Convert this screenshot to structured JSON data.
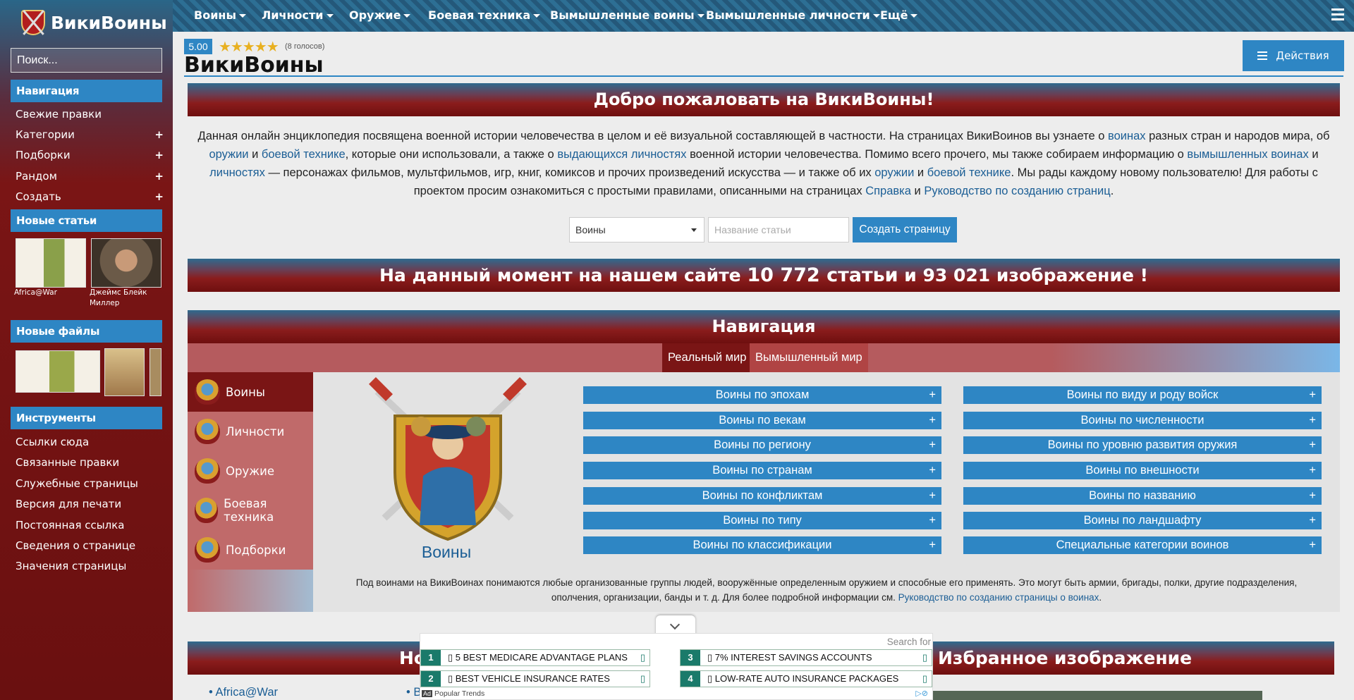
{
  "site": {
    "name": "ВикиВоины"
  },
  "topnav": {
    "items": [
      "Воины",
      "Личности",
      "Оружие",
      "Боевая техника",
      "Вымышленные воины",
      "Вымышленные личности",
      "Ещё"
    ]
  },
  "sidebar": {
    "search_placeholder": "Поиск...",
    "navigation_header": "Навигация",
    "navigation_items": [
      {
        "label": "Свежие правки",
        "plus": ""
      },
      {
        "label": "Категории",
        "plus": "+"
      },
      {
        "label": "Подборки",
        "plus": "+"
      },
      {
        "label": "Рандом",
        "plus": "+"
      },
      {
        "label": "Создать",
        "plus": "+"
      }
    ],
    "new_articles_header": "Новые статьи",
    "new_articles": [
      {
        "caption": "Africa@War"
      },
      {
        "caption": "Джеймс Блейк Миллер"
      }
    ],
    "new_files_header": "Новые файлы",
    "tools_header": "Инструменты",
    "tools_items": [
      "Ссылки сюда",
      "Связанные правки",
      "Служебные страницы",
      "Версия для печати",
      "Постоянная ссылка",
      "Сведения о странице",
      "Значения страницы"
    ]
  },
  "rating": {
    "value": "5.00",
    "votes": "(8 голосов)",
    "stars": 5
  },
  "page": {
    "title": "ВикиВоины",
    "actions_label": "Действия",
    "welcome": "Добро пожаловать на ВикиВоины!",
    "intro": {
      "t1": "Данная онлайн энциклопедия посвящена военной истории человечества в целом и её визуальной составляющей в частности. На страницах ВикиВоинов вы узнаете о ",
      "l1": "воинах",
      "t2": " разных стран и народов мира, об ",
      "l2": "оружии",
      "t3": " и ",
      "l3": "боевой технике",
      "t4": ", которые они использовали, а также о ",
      "l4": "выдающихся личностях",
      "t5": " военной истории человечества. Помимо всего прочего, мы также собираем информацию о ",
      "l5": "вымышленных воинах",
      "t6": " и ",
      "l6": "личностях",
      "t7": " — персонажах фильмов, мультфильмов, игр, книг, комиксов и прочих произведений искусства — и также об их ",
      "l7": "оружии",
      "t8": " и ",
      "l8": "боевой технике",
      "t9": ". Мы рады каждому новому пользователю! Для работы с проектом просим ознакомиться с простыми правилами, описанными на страницах ",
      "l9": "Справка",
      "t10": " и ",
      "l10": "Руководство по созданию страниц",
      "t11": "."
    },
    "create_form": {
      "type_value": "Воины",
      "title_placeholder": "Название статьи",
      "button": "Создать страницу"
    },
    "stats": {
      "pre": "На данный момент на нашем сайте ",
      "articles": "10 772 статьи",
      "mid": " и 93 021 изображение !"
    }
  },
  "navbox": {
    "title": "Навигация",
    "tabs": [
      "Реальный мир",
      "Вымышленный мир"
    ],
    "categories": [
      "Воины",
      "Личности",
      "Оружие",
      "Боевая техника",
      "Подборки"
    ],
    "emblem_caption": "Воины",
    "left_links": [
      "Воины по эпохам",
      "Воины по векам",
      "Воины по региону",
      "Воины по странам",
      "Воины по конфликтам",
      "Воины по типу",
      "Воины по классификации"
    ],
    "right_links": [
      "Воины по виду и роду войск",
      "Воины по численности",
      "Воины по уровню развития оружия",
      "Воины по внешности",
      "Воины по названию",
      "Воины по ландшафту",
      "Специальные категории воинов"
    ],
    "plus": "+",
    "description": "Под воинами на ВикиВоинах понимаются любые организованные группы людей, вооружённые определенным оружием и способные его применять. Это могут быть армии, бригады, полки, другие подразделения, ополчения, организации, банды и т. д. Для более подробной информации см. ",
    "description_link": "Руководство по созданию страницы о воинах",
    "description_end": "."
  },
  "bottom": {
    "left_banner": "Но",
    "right_banner": "Избранное изображение",
    "list_item": "Africa@War",
    "list_item2": "Ви"
  },
  "ad": {
    "search": "Search for",
    "items": [
      {
        "num": "1",
        "label": "▯ 5 BEST MEDICARE ADVANTAGE PLANS",
        "arrow": "▯"
      },
      {
        "num": "3",
        "label": "▯ 7% INTEREST SAVINGS ACCOUNTS",
        "arrow": "▯"
      },
      {
        "num": "2",
        "label": "▯ BEST VEHICLE INSURANCE RATES",
        "arrow": "▯"
      },
      {
        "num": "4",
        "label": "▯ LOW-RATE AUTO INSURANCE PACKAGES",
        "arrow": "▯"
      }
    ],
    "ad_mark": "Ad",
    "footer": "Popular Trends"
  },
  "colors": {
    "accent": "#2e86c4",
    "brand_red": "#7a1515",
    "link": "#1b5e95"
  }
}
